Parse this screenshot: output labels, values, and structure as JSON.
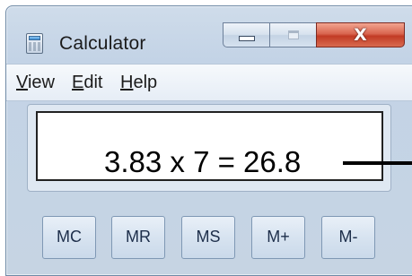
{
  "window": {
    "title": "Calculator"
  },
  "caption": {
    "close_glyph": "X"
  },
  "menu": [
    {
      "accel": "V",
      "rest": "iew"
    },
    {
      "accel": "E",
      "rest": "dit"
    },
    {
      "accel": "H",
      "rest": "elp"
    }
  ],
  "display": {
    "expression": "3.83 x 7 = 26.8"
  },
  "memory_buttons": [
    "MC",
    "MR",
    "MS",
    "M+",
    "M-"
  ],
  "colors": {
    "close_button": "#c23b25",
    "frame": "#c6d4e3"
  }
}
